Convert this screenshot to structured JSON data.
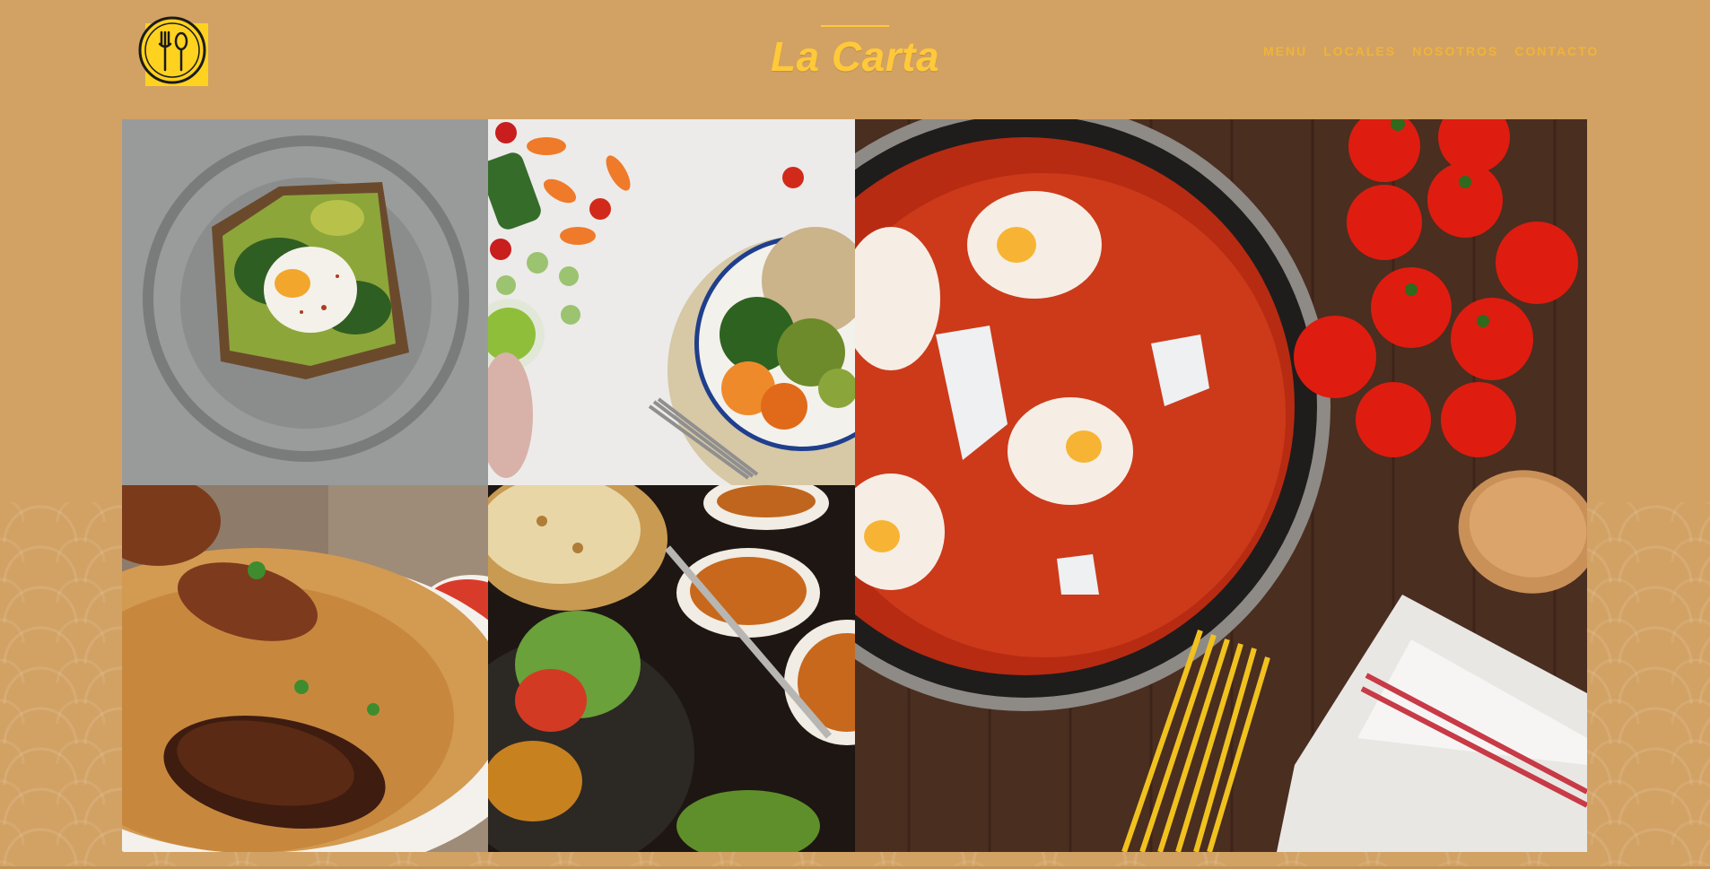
{
  "header": {
    "logo_icon": "fork-spoon-icon",
    "title": "La Carta",
    "nav": [
      "MENU",
      "LOCALES",
      "NOSOTROS",
      "CONTACTO"
    ]
  },
  "gallery": {
    "tiles": [
      {
        "name": "avocado-toast-egg-image"
      },
      {
        "name": "vegetables-bowl-image"
      },
      {
        "name": "biryani-chicken-image"
      },
      {
        "name": "indian-curry-naan-image"
      },
      {
        "name": "shakshuka-tomatoes-pasta-image"
      }
    ]
  },
  "colors": {
    "background": "#d2a264",
    "accent": "#ffc93a",
    "nav": "#efb33a",
    "logo": "#ffd21f"
  }
}
